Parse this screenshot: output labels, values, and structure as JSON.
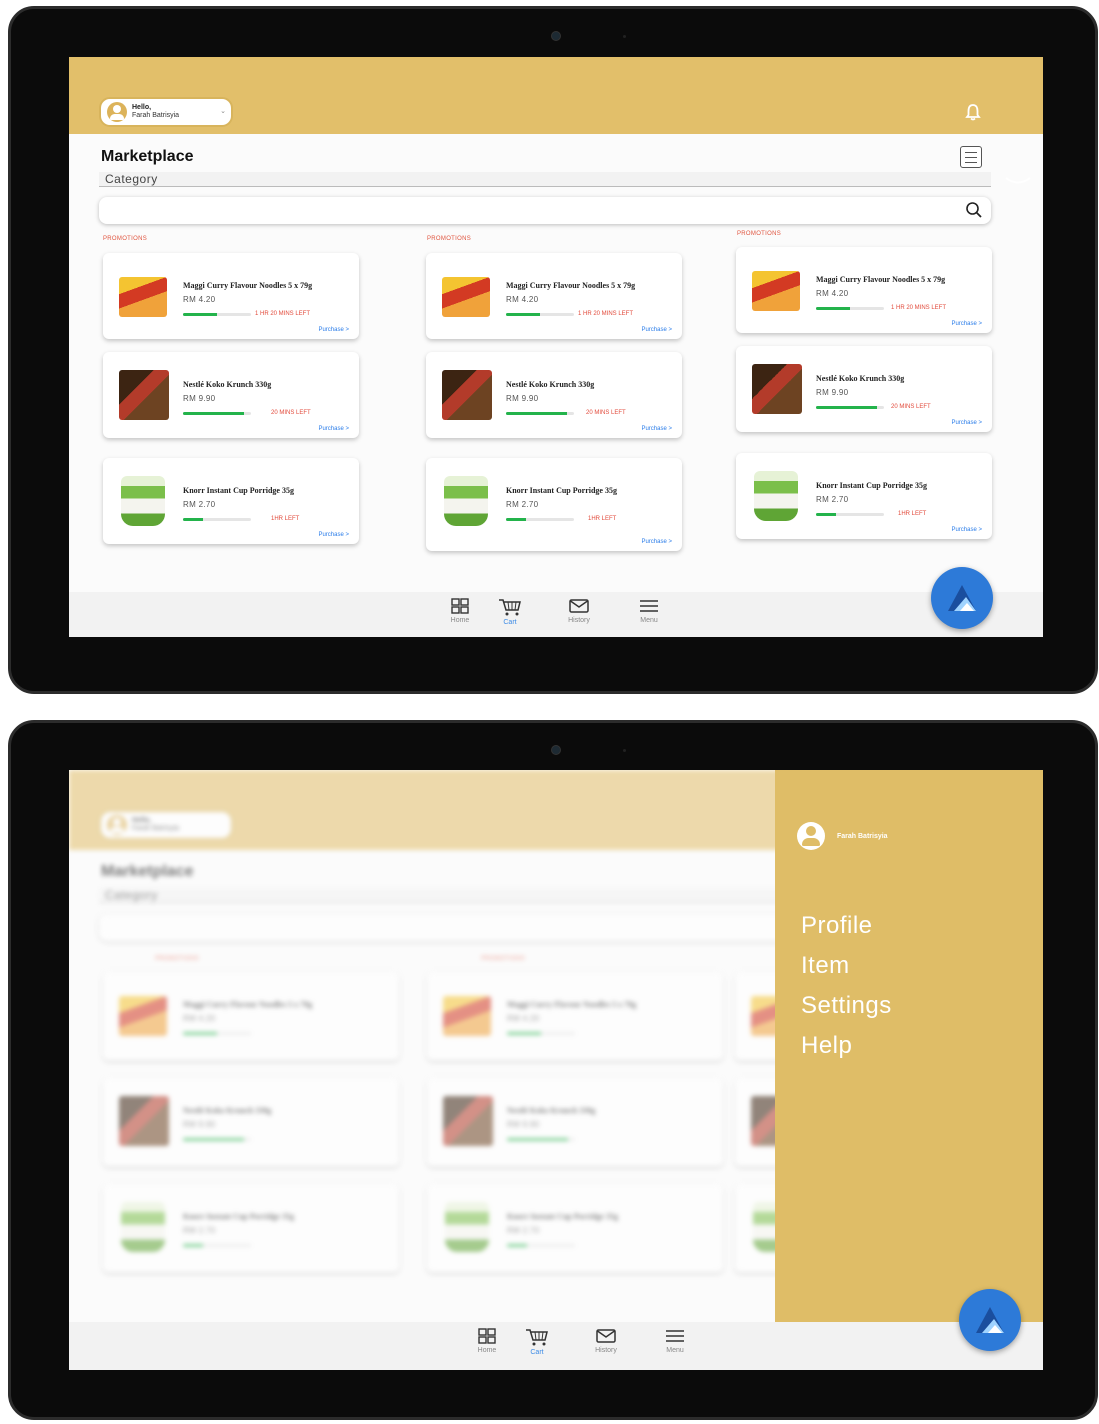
{
  "user": {
    "hello": "Hello,",
    "name": "Farah Batrisyia"
  },
  "page": {
    "title": "Marketplace",
    "category_placeholder": "Category"
  },
  "columns": [
    "PROMOTIONS",
    "PROMOTIONS",
    "PROMOTIONS"
  ],
  "products": [
    {
      "name": "Maggi Curry Flavour Noodles 5 x 79g",
      "price": "RM 4.20",
      "time_left": "1 HR 20 MINS LEFT",
      "progress": 0.5,
      "action": "Purchase >"
    },
    {
      "name": "Nestlé Koko Krunch 330g",
      "price": "RM 9.90",
      "time_left": "20 MINS LEFT",
      "progress": 0.9,
      "action": "Purchase >"
    },
    {
      "name": "Knorr Instant Cup Porridge 35g",
      "price": "RM 2.70",
      "time_left": "1HR LEFT",
      "progress": 0.3,
      "action": "Purchase >"
    }
  ],
  "nav": [
    {
      "label": "Home",
      "icon": "home-grid-icon"
    },
    {
      "label": "Cart",
      "icon": "cart-icon",
      "active": true
    },
    {
      "label": "History",
      "icon": "mail-icon"
    },
    {
      "label": "Menu",
      "icon": "menu-icon"
    }
  ],
  "drawer": {
    "user_name": "Farah Batrisyia",
    "items": [
      "Profile",
      "Item",
      "Settings",
      "Help"
    ]
  },
  "colors": {
    "header": "#e2bf6a",
    "drawer": "#dfbd67",
    "accent": "#2d7ad8",
    "progress": "#23b34b",
    "alert": "#e24a3b",
    "link": "#2b7de9"
  }
}
